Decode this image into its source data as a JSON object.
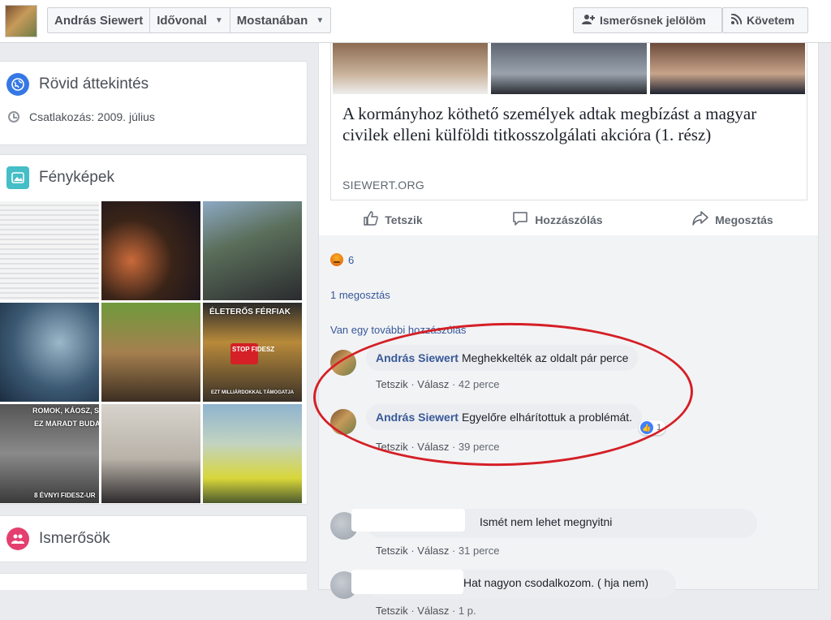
{
  "header": {
    "profile_name": "András Siewert",
    "tab_timeline": "Idővonal",
    "tab_recent": "Mostanában",
    "add_friend_label": "Ismerősnek jelölöm",
    "follow_label": "Követem"
  },
  "intro": {
    "title": "Rövid áttekintés",
    "joined": "Csatlakozás: 2009. július"
  },
  "photos": {
    "title": "Fényképek",
    "tile_captions": [
      "ÉLETERŐS FÉRFIAK",
      "STOP FIDESZ",
      "EZT MILLIÁRDOKKAL TÁMOGATJA",
      "ROMOK, KÁOSZ, S",
      "EZ MARADT BUDA",
      "8 ÉVNYI FIDESZ-UR"
    ]
  },
  "friends": {
    "title": "Ismerősök"
  },
  "post": {
    "link_title": "A kormányhoz köthető személyek adtak megbízást a magyar civilek elleni külföldi titkosszolgálati akcióra (1. rész)",
    "link_domain": "SIEWERT.ORG",
    "actions": {
      "like": "Tetszik",
      "comment": "Hozzászólás",
      "share": "Megosztás"
    },
    "reaction_count": "6",
    "shares": "1 megosztás",
    "more_comments": "Van egy további hozzászólás"
  },
  "comments": [
    {
      "author": "András Siewert",
      "text": "Meghekkelték az oldalt pár perce",
      "like": "Tetszik",
      "reply": "Válasz",
      "time": "42 perce"
    },
    {
      "author": "András Siewert",
      "text": "Egyelőre elhárítottuk a problémát.",
      "like": "Tetszik",
      "reply": "Válasz",
      "time": "39 perce",
      "likes": "1"
    },
    {
      "author": "",
      "text": "Ismét nem lehet megnyitni",
      "like": "Tetszik",
      "reply": "Válasz",
      "time": "31 perce"
    },
    {
      "author": "",
      "text": "Hat nagyon csodalkozom. ( hja nem)",
      "like": "Tetszik",
      "reply": "Válasz",
      "time": "1 p."
    }
  ],
  "colors": {
    "link": "#385898",
    "annotation": "#d42026",
    "intro_icon": "#3578e5",
    "photos_icon": "#44bec7",
    "friends_icon": "#e4406f"
  },
  "icons": [
    "globe-icon",
    "clock-icon",
    "photo-icon",
    "friends-icon",
    "add-friend-icon",
    "rss-icon",
    "like-icon",
    "comment-icon",
    "share-icon",
    "angry-reaction-icon"
  ]
}
